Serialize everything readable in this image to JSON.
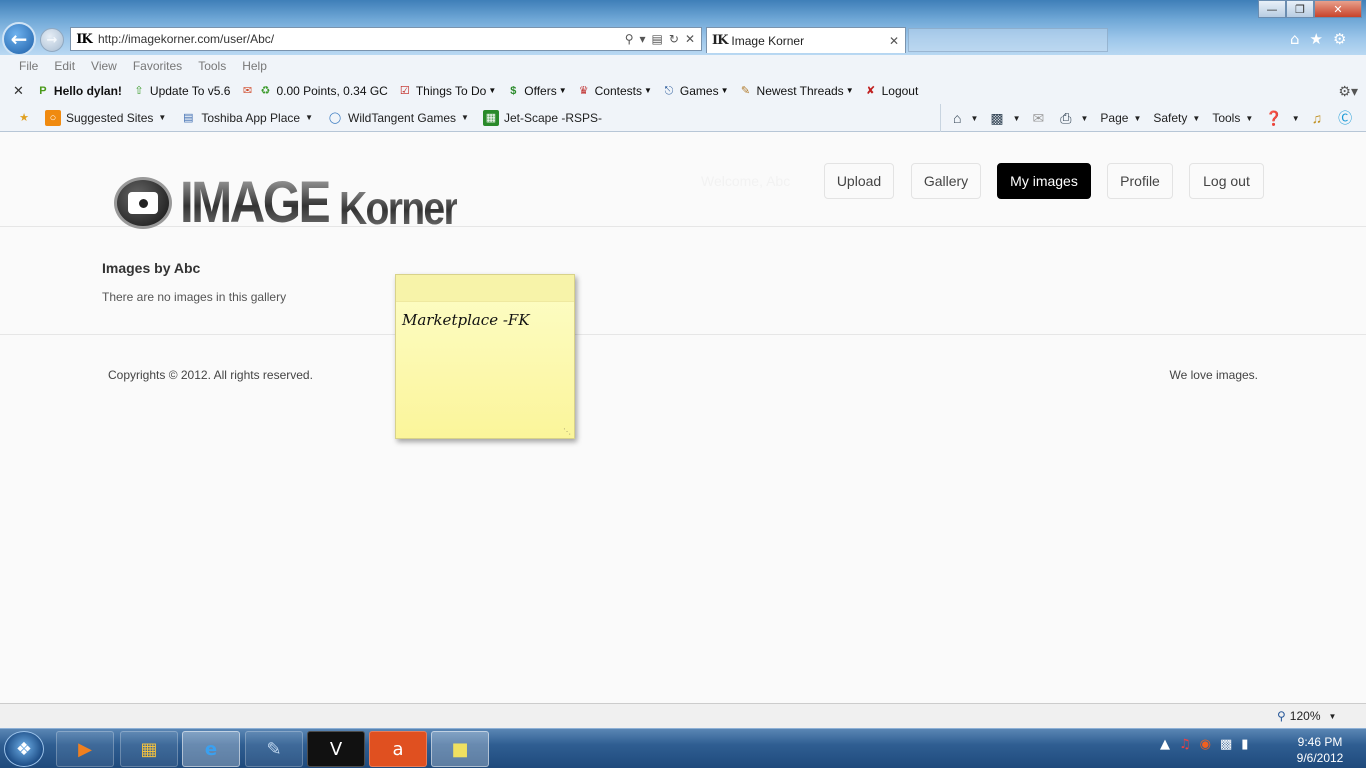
{
  "browser": {
    "url": "http://imagekorner.com/user/Abc/",
    "favicon_text": "IK",
    "tab_title": "Image Korner",
    "menu": [
      "File",
      "Edit",
      "View",
      "Favorites",
      "Tools",
      "Help"
    ],
    "toolbar": {
      "greeting": "Hello dylan!",
      "update": "Update To v5.6",
      "points": "0.00 Points, 0.34 GC",
      "todo": "Things To Do",
      "offers": "Offers",
      "contests": "Contests",
      "games": "Games",
      "threads": "Newest Threads",
      "logout": "Logout"
    },
    "favorites_bar": {
      "suggested": "Suggested Sites",
      "toshiba": "Toshiba App Place",
      "wildtangent": "WildTangent Games",
      "jetscape": "Jet-Scape -RSPS-"
    },
    "command_bar": {
      "page": "Page",
      "safety": "Safety",
      "tools": "Tools"
    },
    "zoom": "120%"
  },
  "site": {
    "logo_word1": "IMAGE",
    "logo_word2": "Korner",
    "welcome": "Welcome, Abc",
    "nav": {
      "upload": "Upload",
      "gallery": "Gallery",
      "my_images": "My images",
      "profile": "Profile",
      "logout": "Log out"
    },
    "content": {
      "title": "Images by Abc",
      "empty": "There are no images in this gallery"
    },
    "footer": {
      "copyright": "Copyrights © 2012. All rights reserved.",
      "tagline": "We love images."
    }
  },
  "sticky_note": {
    "text": "Marketplace -FK"
  },
  "taskbar": {
    "time": "9:46 PM",
    "date": "9/6/2012"
  }
}
